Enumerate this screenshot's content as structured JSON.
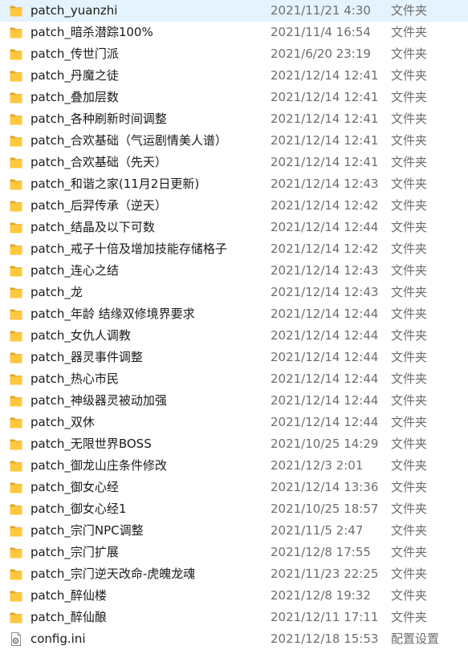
{
  "colors": {
    "folder_back": "#dca52a",
    "folder_front": "#ffc83d",
    "date_text": "#6d6d6d",
    "name_text": "#1a1a1a"
  },
  "rows": [
    {
      "name": "patch_yuanzhi",
      "date": "2021/11/21 4:30",
      "type": "文件夹",
      "icon": "folder-icon"
    },
    {
      "name": "patch_暗杀潜踪100%",
      "date": "2021/11/4 16:54",
      "type": "文件夹",
      "icon": "folder-icon"
    },
    {
      "name": "patch_传世门派",
      "date": "2021/6/20 23:19",
      "type": "文件夹",
      "icon": "folder-icon"
    },
    {
      "name": "patch_丹魔之徒",
      "date": "2021/12/14 12:41",
      "type": "文件夹",
      "icon": "folder-icon"
    },
    {
      "name": "patch_叠加层数",
      "date": "2021/12/14 12:41",
      "type": "文件夹",
      "icon": "folder-icon"
    },
    {
      "name": "patch_各种刷新时间调整",
      "date": "2021/12/14 12:41",
      "type": "文件夹",
      "icon": "folder-icon"
    },
    {
      "name": "patch_合欢基础（气运剧情美人谱）",
      "date": "2021/12/14 12:41",
      "type": "文件夹",
      "icon": "folder-icon"
    },
    {
      "name": "patch_合欢基础（先天）",
      "date": "2021/12/14 12:41",
      "type": "文件夹",
      "icon": "folder-icon"
    },
    {
      "name": "patch_和谐之家(11月2日更新)",
      "date": "2021/12/14 12:43",
      "type": "文件夹",
      "icon": "folder-icon"
    },
    {
      "name": "patch_后羿传承（逆天）",
      "date": "2021/12/14 12:42",
      "type": "文件夹",
      "icon": "folder-icon"
    },
    {
      "name": "patch_结晶及以下可数",
      "date": "2021/12/14 12:44",
      "type": "文件夹",
      "icon": "folder-icon"
    },
    {
      "name": "patch_戒子十倍及增加技能存储格子",
      "date": "2021/12/14 12:42",
      "type": "文件夹",
      "icon": "folder-icon"
    },
    {
      "name": "patch_连心之结",
      "date": "2021/12/14 12:43",
      "type": "文件夹",
      "icon": "folder-icon"
    },
    {
      "name": "patch_龙",
      "date": "2021/12/14 12:43",
      "type": "文件夹",
      "icon": "folder-icon"
    },
    {
      "name": "patch_年龄 结缘双修境界要求",
      "date": "2021/12/14 12:44",
      "type": "文件夹",
      "icon": "folder-icon"
    },
    {
      "name": "patch_女仇人调教",
      "date": "2021/12/14 12:44",
      "type": "文件夹",
      "icon": "folder-icon"
    },
    {
      "name": "patch_器灵事件调整",
      "date": "2021/12/14 12:44",
      "type": "文件夹",
      "icon": "folder-icon"
    },
    {
      "name": "patch_热心市民",
      "date": "2021/12/14 12:44",
      "type": "文件夹",
      "icon": "folder-icon"
    },
    {
      "name": "patch_神级器灵被动加强",
      "date": "2021/12/14 12:44",
      "type": "文件夹",
      "icon": "folder-icon"
    },
    {
      "name": "patch_双休",
      "date": "2021/12/14 12:44",
      "type": "文件夹",
      "icon": "folder-icon"
    },
    {
      "name": "patch_无限世界BOSS",
      "date": "2021/10/25 14:29",
      "type": "文件夹",
      "icon": "folder-icon"
    },
    {
      "name": "patch_御龙山庄条件修改",
      "date": "2021/12/3 2:01",
      "type": "文件夹",
      "icon": "folder-icon"
    },
    {
      "name": "patch_御女心经",
      "date": "2021/12/14 13:36",
      "type": "文件夹",
      "icon": "folder-icon"
    },
    {
      "name": "patch_御女心经1",
      "date": "2021/10/25 18:57",
      "type": "文件夹",
      "icon": "folder-icon"
    },
    {
      "name": "patch_宗门NPC调整",
      "date": "2021/11/5 2:47",
      "type": "文件夹",
      "icon": "folder-icon"
    },
    {
      "name": "patch_宗门扩展",
      "date": "2021/12/8 17:55",
      "type": "文件夹",
      "icon": "folder-icon"
    },
    {
      "name": "patch_宗门逆天改命-虎魄龙魂",
      "date": "2021/11/23 22:25",
      "type": "文件夹",
      "icon": "folder-icon"
    },
    {
      "name": "patch_醉仙楼",
      "date": "2021/12/8 19:32",
      "type": "文件夹",
      "icon": "folder-icon"
    },
    {
      "name": "patch_醉仙酿",
      "date": "2021/12/11 17:11",
      "type": "文件夹",
      "icon": "folder-icon"
    },
    {
      "name": "config.ini",
      "date": "2021/12/18 15:53",
      "type": "配置设置",
      "icon": "config-file-icon"
    }
  ]
}
